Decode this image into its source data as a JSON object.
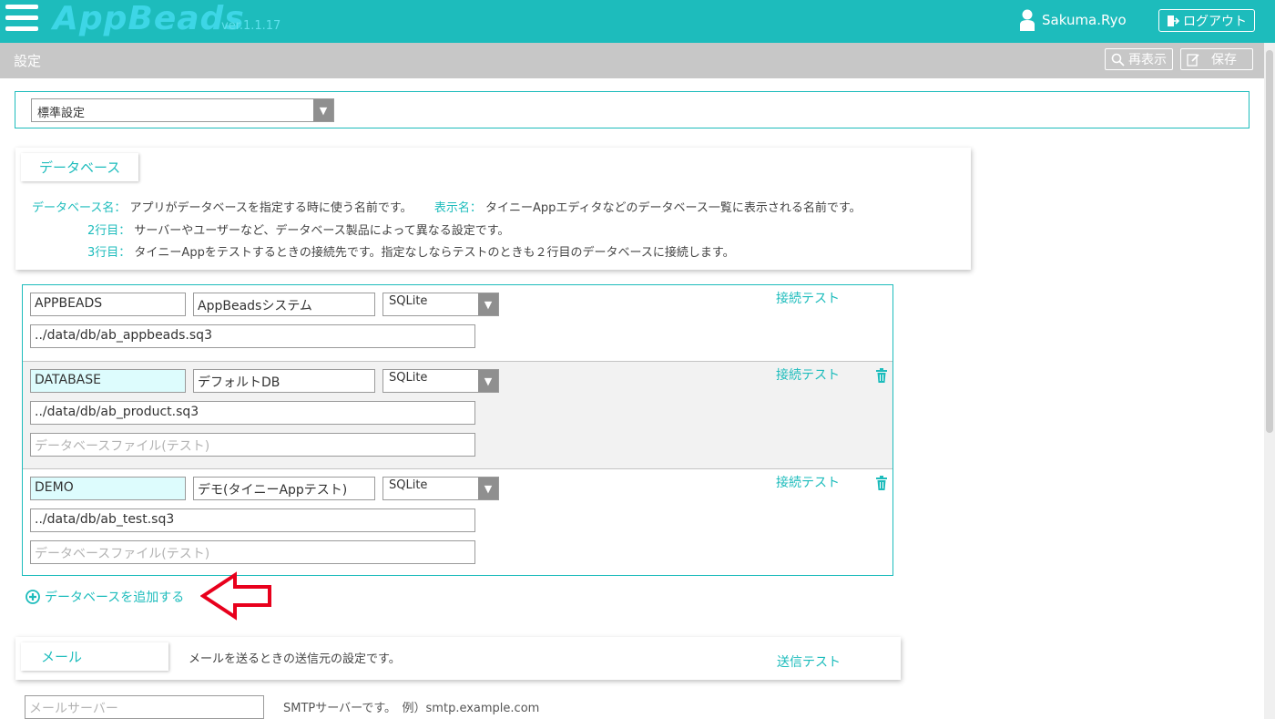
{
  "header": {
    "app_name": "AppBeads",
    "version": "ver.1.1.17",
    "user_name": "Sakuma.Ryo",
    "logout_label": "ログアウト",
    "colors": {
      "accent": "#1dbcbc",
      "logo": "#3dd6e6"
    }
  },
  "subbar": {
    "title": "設定",
    "refresh_label": "再表示",
    "save_label": "保存"
  },
  "preset": {
    "selected": "標準設定"
  },
  "database_section": {
    "tab_label": "データベース",
    "help": {
      "name_key": "データベース名：",
      "name_desc": "アプリがデータベースを指定する時に使う名前です。",
      "display_key": "表示名：",
      "display_desc": "タイニーAppエディタなどのデータベース一覧に表示される名前です。",
      "row2_key": "2行目：",
      "row2_desc": "サーバーやユーザーなど、データベース製品によって異なる設定です。",
      "row3_key": "3行目：",
      "row3_desc": "タイニーAppをテストするときの接続先です。指定なしならテストのときも２行目のデータベースに接続します。"
    },
    "connect_test_label": "接続テスト",
    "test_file_placeholder": "データベースファイル(テスト)",
    "items": [
      {
        "name": "APPBEADS",
        "display": "AppBeadsシステム",
        "type": "SQLite",
        "path": "../data/db/ab_appbeads.sq3"
      },
      {
        "name": "DATABASE",
        "display": "デフォルトDB",
        "type": "SQLite",
        "path": "../data/db/ab_product.sq3"
      },
      {
        "name": "DEMO",
        "display": "デモ(タイニーAppテスト)",
        "type": "SQLite",
        "path": "../data/db/ab_test.sq3"
      }
    ],
    "add_label": "データベースを追加する"
  },
  "mail_section": {
    "tab_label": "メール",
    "desc": "メールを送るときの送信元の設定です。",
    "send_test_label": "送信テスト",
    "server_placeholder": "メールサーバー",
    "server_help": "SMTPサーバーです。　例）smtp.example.com"
  }
}
